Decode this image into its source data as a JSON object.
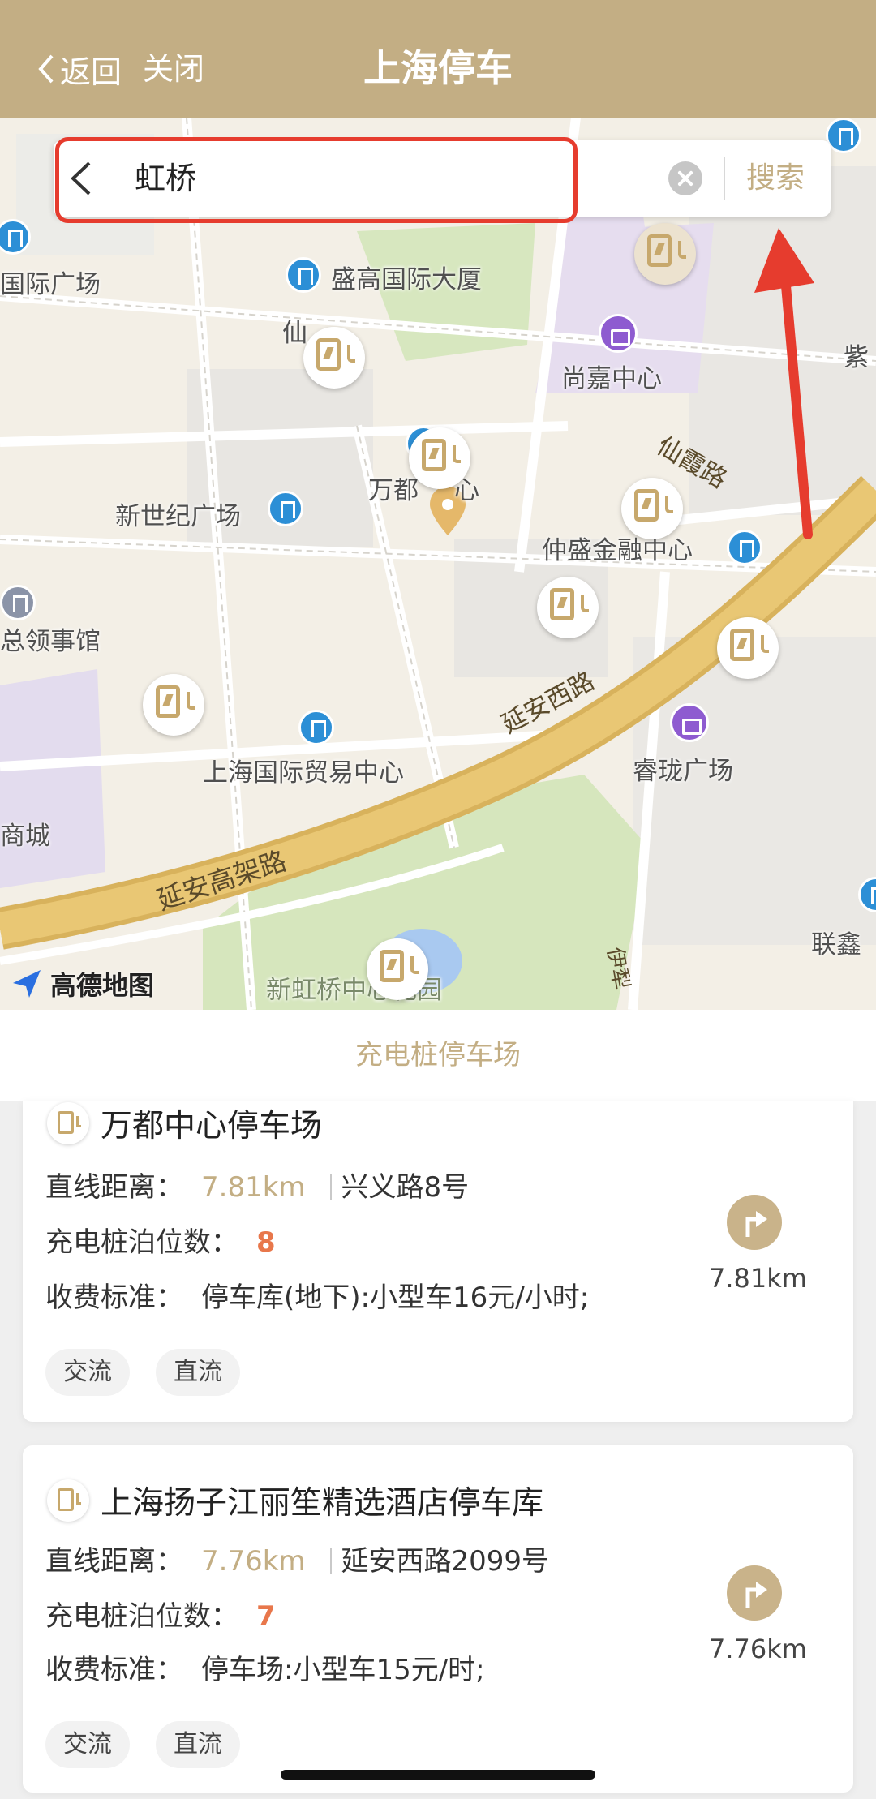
{
  "header": {
    "back_label": "返回",
    "close_label": "关闭",
    "title": "上海停车"
  },
  "search": {
    "query": "虹桥",
    "button_label": "搜索"
  },
  "map": {
    "provider_label": "高德地图",
    "pois": {
      "intl_plaza": "国际广场",
      "shenggao": "盛高国际大厦",
      "xian": "仙",
      "shangjia": "尚嘉中心",
      "zi": "紫",
      "wandu": "万都",
      "wandu_suffix": "心",
      "xinshiji": "新世纪广场",
      "xianxia_road": "仙霞路",
      "zhongsheng": "仲盛金融中心",
      "consulate": "总领事馆",
      "yanan_west": "延安西路",
      "trade_center": "上海国际贸易中心",
      "ruilong": "睿珑广场",
      "mall": "商城",
      "yanan_elevated": "延安高架路",
      "lianxin": "联鑫",
      "park": "新虹桥中心花园",
      "yi": "伊犁"
    }
  },
  "sheet": {
    "title": "充电桩停车场"
  },
  "labels": {
    "distance": "直线距离：",
    "count": "充电桩泊位数：",
    "fee": "收费标准："
  },
  "lots": [
    {
      "name": "万都中心停车场",
      "distance": "7.81km",
      "address": "兴义路8号",
      "count": "8",
      "fee": "停车库(地下):小型车16元/小时;",
      "nav_distance": "7.81km",
      "tags": [
        "交流",
        "直流"
      ]
    },
    {
      "name": "上海扬子江丽笙精选酒店停车库",
      "distance": "7.76km",
      "address": "延安西路2099号",
      "count": "7",
      "fee": "停车场:小型车15元/时;",
      "nav_distance": "7.76km",
      "tags": [
        "交流",
        "直流"
      ]
    }
  ],
  "colors": {
    "brand": "#c3ae84",
    "highlight": "#e63c2e",
    "count": "#e8774b"
  }
}
